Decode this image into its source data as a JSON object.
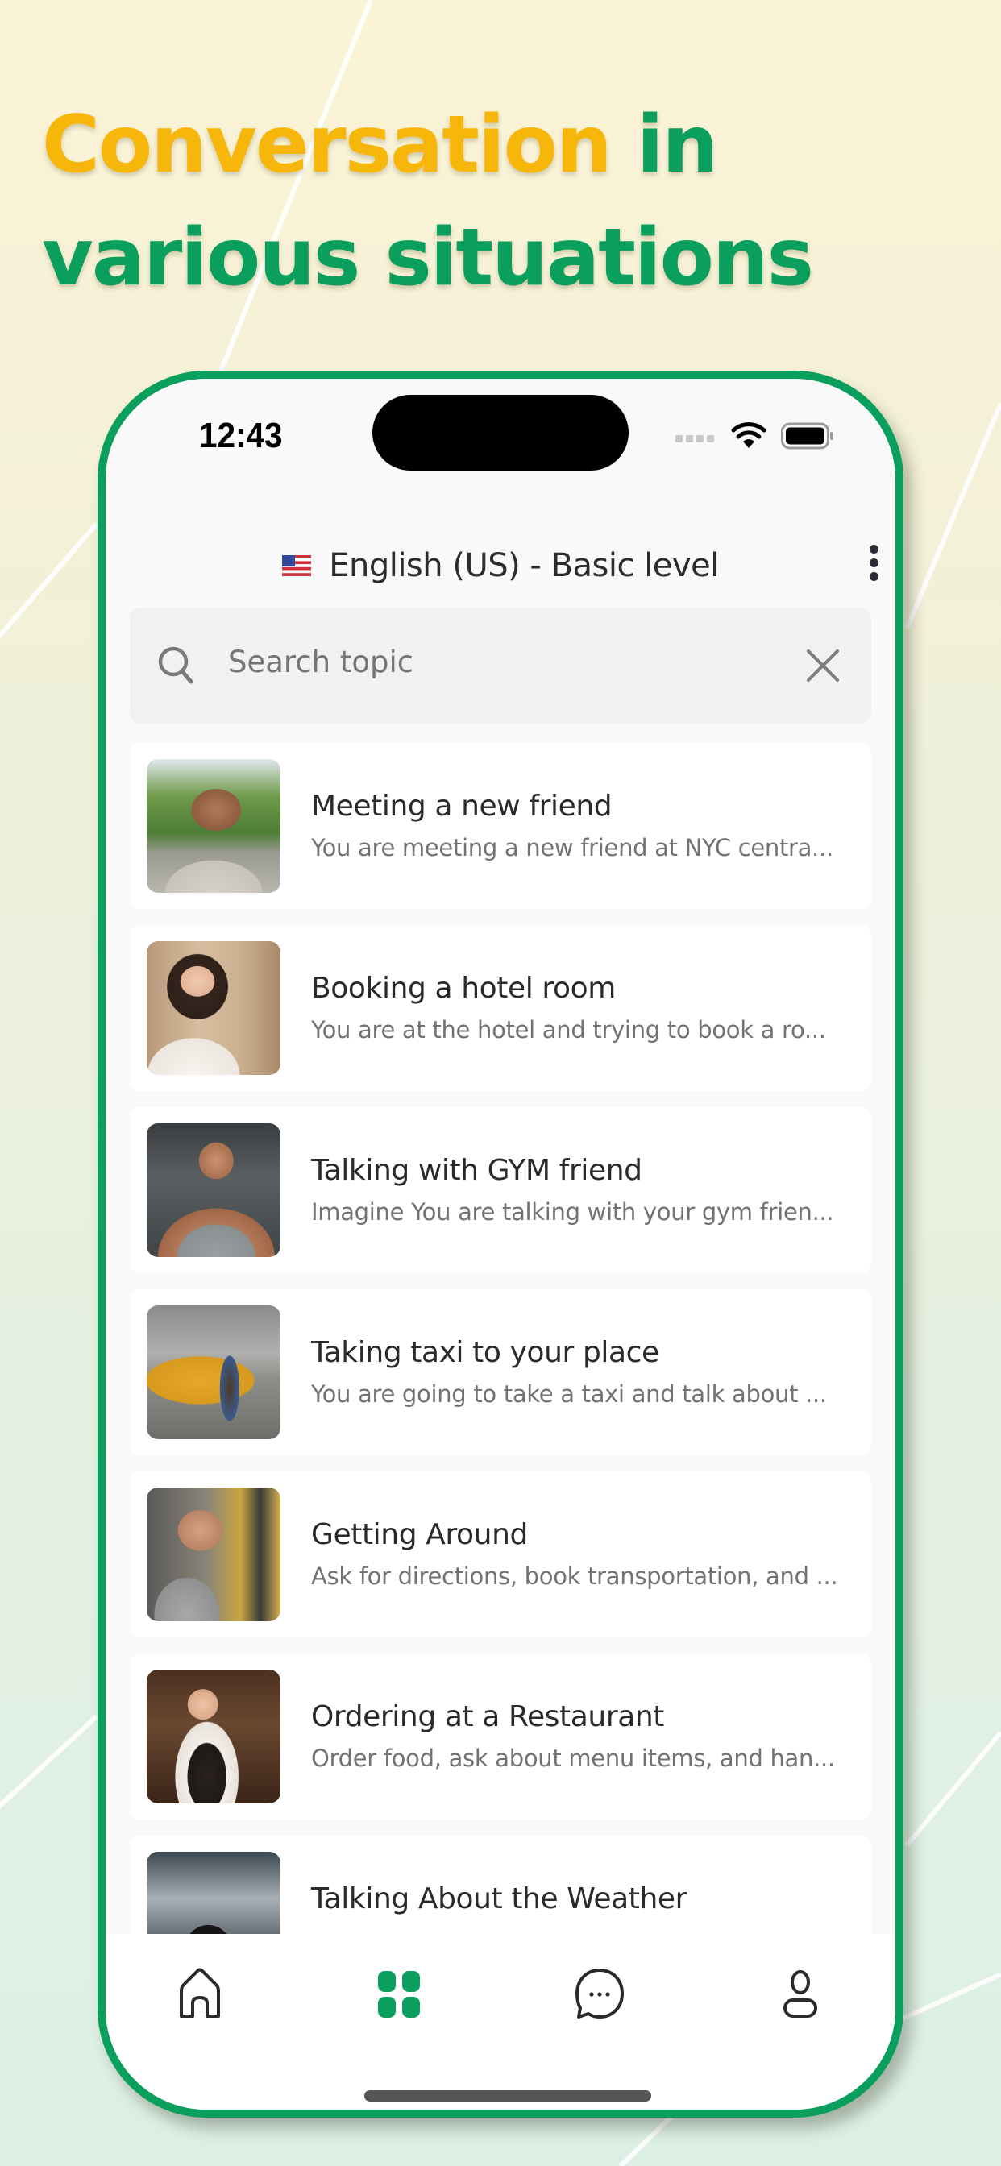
{
  "headline": {
    "highlight": "Conversation",
    "rest_line1": " in",
    "line2": "various situations",
    "highlight_color": "#f7b70a",
    "accent_color": "#0a9f5c"
  },
  "status_bar": {
    "time": "12:43"
  },
  "header": {
    "flag_icon": "us-flag-icon",
    "language_label": "English (US) - Basic level",
    "menu_icon": "more-vertical-icon"
  },
  "search": {
    "placeholder": "Search topic",
    "value": "",
    "search_icon": "search-icon",
    "clear_icon": "close-icon"
  },
  "topics": [
    {
      "title": "Meeting a new friend",
      "subtitle": "You are meeting a new friend at NYC centra...",
      "image": "man-in-park-photo"
    },
    {
      "title": "Booking a hotel room",
      "subtitle": "You are at the hotel and trying to book a ro...",
      "image": "hotel-receptionist-photo"
    },
    {
      "title": "Talking with GYM friend",
      "subtitle": "Imagine You are talking with your gym frien...",
      "image": "gym-man-photo"
    },
    {
      "title": "Taking taxi to your place",
      "subtitle": "You are going to take a taxi and talk about ...",
      "image": "taxi-driver-photo"
    },
    {
      "title": "Getting Around",
      "subtitle": "Ask for directions, book transportation, and ...",
      "image": "bus-passenger-photo"
    },
    {
      "title": "Ordering at a Restaurant",
      "subtitle": "Order food, ask about menu items, and han...",
      "image": "waitress-photo"
    },
    {
      "title": "Talking About the Weather",
      "subtitle": "",
      "image": "snowy-street-photo"
    }
  ],
  "bottom_nav": {
    "items": [
      {
        "name": "home",
        "icon": "home-icon",
        "active": false
      },
      {
        "name": "topics",
        "icon": "grid-icon",
        "active": true
      },
      {
        "name": "chat",
        "icon": "chat-bubble-icon",
        "active": false
      },
      {
        "name": "profile",
        "icon": "user-icon",
        "active": false
      }
    ],
    "active_color": "#0a9f5c",
    "inactive_color": "#2a2a2a"
  }
}
